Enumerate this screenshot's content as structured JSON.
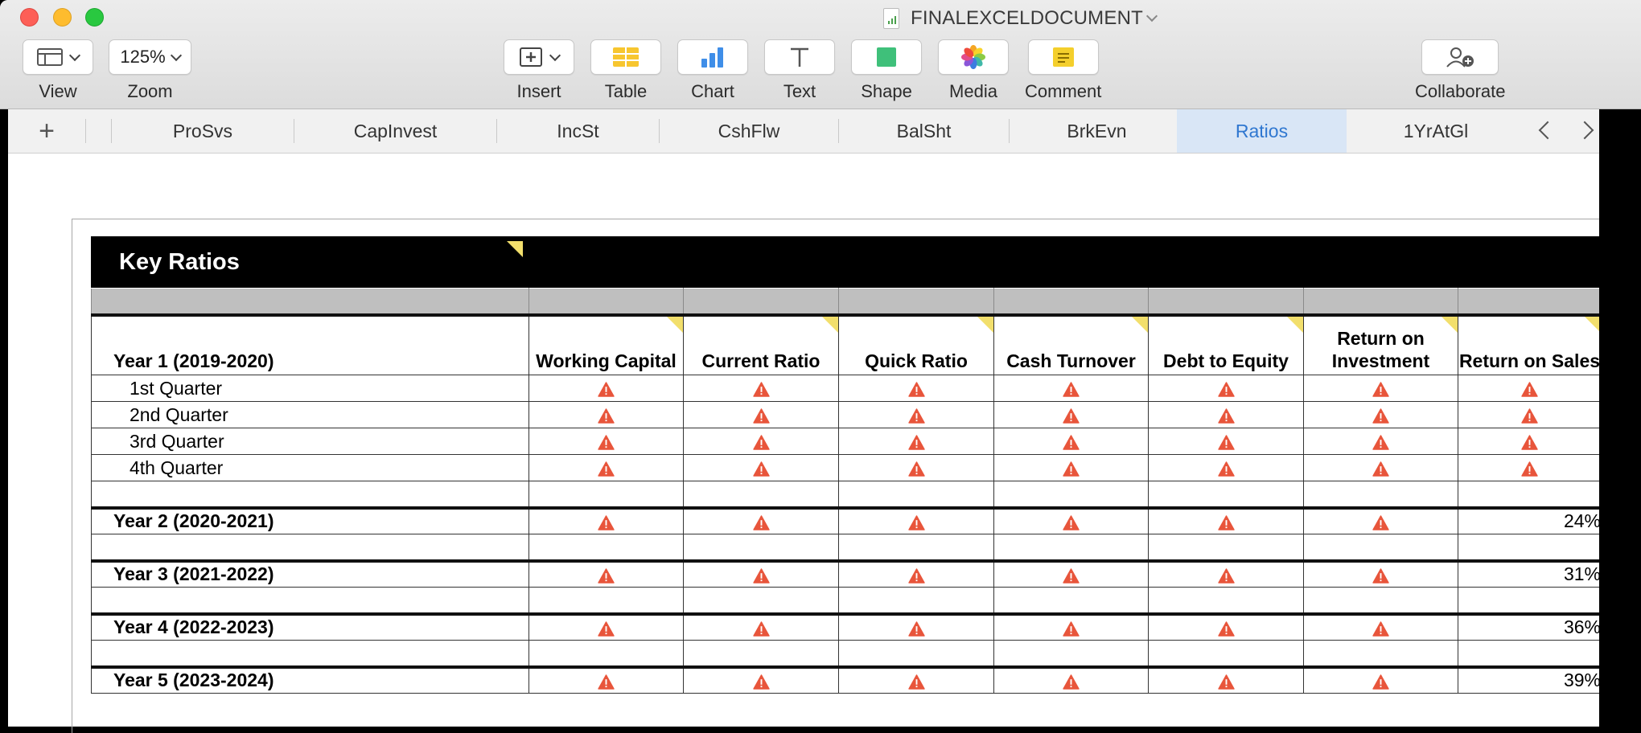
{
  "window": {
    "document_title": "FINALEXCELDOCUMENT"
  },
  "toolbar": {
    "view_label": "View",
    "zoom_label": "Zoom",
    "zoom_value": "125%",
    "insert_label": "Insert",
    "table_label": "Table",
    "chart_label": "Chart",
    "text_label": "Text",
    "shape_label": "Shape",
    "media_label": "Media",
    "comment_label": "Comment",
    "collaborate_label": "Collaborate"
  },
  "sheet_tabs": [
    {
      "label": "ProSvs",
      "active": false
    },
    {
      "label": "CapInvest",
      "active": false
    },
    {
      "label": "IncSt",
      "active": false
    },
    {
      "label": "CshFlw",
      "active": false
    },
    {
      "label": "BalSht",
      "active": false
    },
    {
      "label": "BrkEvn",
      "active": false
    },
    {
      "label": "Ratios",
      "active": true
    },
    {
      "label": "1YrAtGl",
      "active": false
    }
  ],
  "table": {
    "title": "Key Ratios",
    "header_row_label": "Year 1  (2019-2020)",
    "columns": [
      "Working Capital",
      "Current Ratio",
      "Quick Ratio",
      "Cash Turnover",
      "Debt to Equity",
      "Return on Investment",
      "Return on Sales"
    ],
    "quarters": [
      "1st Quarter",
      "2nd Quarter",
      "3rd Quarter",
      "4th Quarter"
    ],
    "years": [
      {
        "label": "Year 2  (2020-2021)",
        "return_on_sales": "24%"
      },
      {
        "label": "Year 3  (2021-2022)",
        "return_on_sales": "31%"
      },
      {
        "label": "Year 4  (2022-2023)",
        "return_on_sales": "36%"
      },
      {
        "label": "Year 5  (2023-2024)",
        "return_on_sales": "39%"
      }
    ],
    "error_icon": "warning-triangle-icon",
    "error_color": "#e8553b"
  }
}
